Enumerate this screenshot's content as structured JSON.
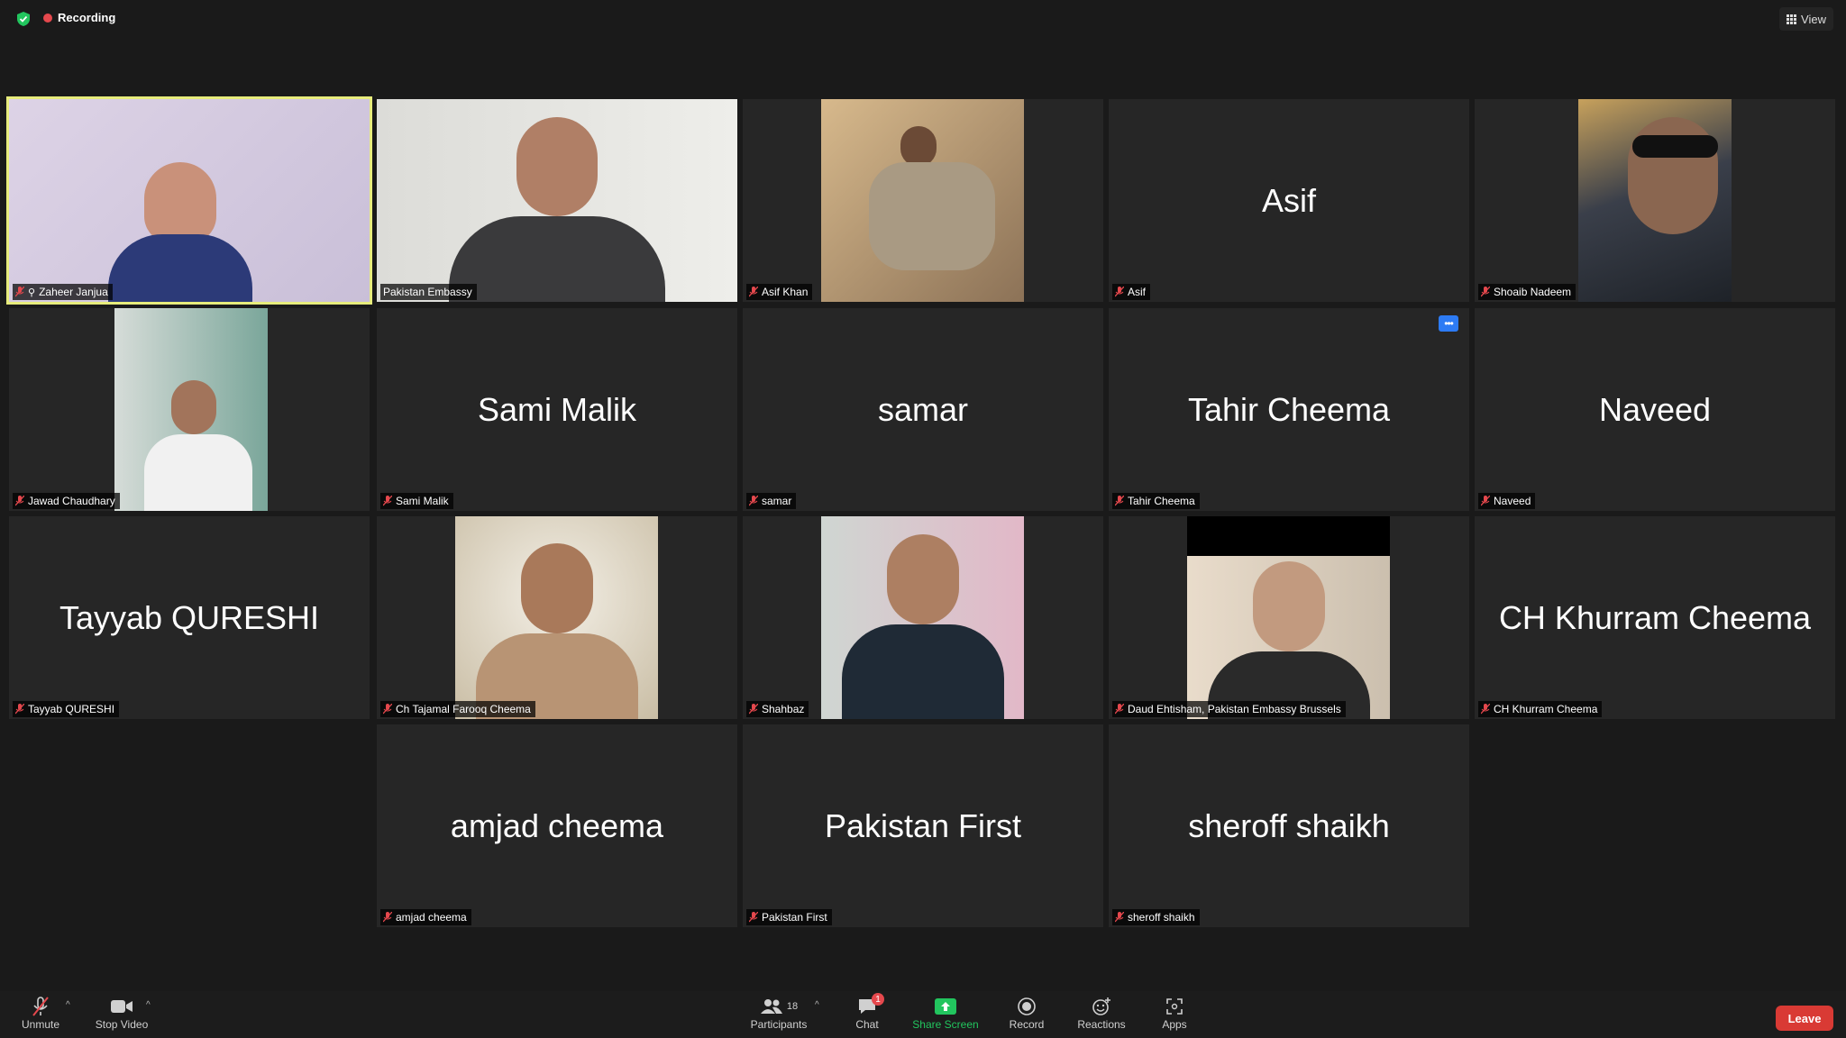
{
  "topbar": {
    "recording_label": "Recording",
    "view_label": "View"
  },
  "tiles": [
    {
      "name": "Zaheer Janjua",
      "big": ""
    },
    {
      "name": "Pakistan Embassy",
      "big": ""
    },
    {
      "name": "Asif Khan",
      "big": ""
    },
    {
      "name": "Asif",
      "big": "Asif"
    },
    {
      "name": "Shoaib Nadeem",
      "big": ""
    },
    {
      "name": "Jawad Chaudhary",
      "big": ""
    },
    {
      "name": "Sami Malik",
      "big": "Sami Malik"
    },
    {
      "name": "samar",
      "big": "samar"
    },
    {
      "name": "Tahir Cheema",
      "big": "Tahir Cheema"
    },
    {
      "name": "Naveed",
      "big": "Naveed"
    },
    {
      "name": "Tayyab QURESHI",
      "big": "Tayyab QURESHI"
    },
    {
      "name": "Ch Tajamal Farooq Cheema",
      "big": ""
    },
    {
      "name": "Shahbaz",
      "big": ""
    },
    {
      "name": "Daud Ehtisham, Pakistan Embassy Brussels",
      "big": ""
    },
    {
      "name": "CH Khurram Cheema",
      "big": "CH Khurram Cheema"
    },
    {
      "name": "amjad cheema",
      "big": "amjad cheema"
    },
    {
      "name": "Pakistan First",
      "big": "Pakistan First"
    },
    {
      "name": "sheroff shaikh",
      "big": "sheroff shaikh"
    }
  ],
  "toolbar": {
    "unmute": "Unmute",
    "stop_video": "Stop Video",
    "participants": "Participants",
    "participants_count": "18",
    "chat": "Chat",
    "chat_badge": "1",
    "share_screen": "Share Screen",
    "record": "Record",
    "reactions": "Reactions",
    "apps": "Apps",
    "leave": "Leave"
  },
  "colors": {
    "active_speaker_border": "#e7ec7c",
    "share_green": "#22c55e",
    "leave_red": "#d93a34",
    "recording_red": "#e5484d"
  }
}
